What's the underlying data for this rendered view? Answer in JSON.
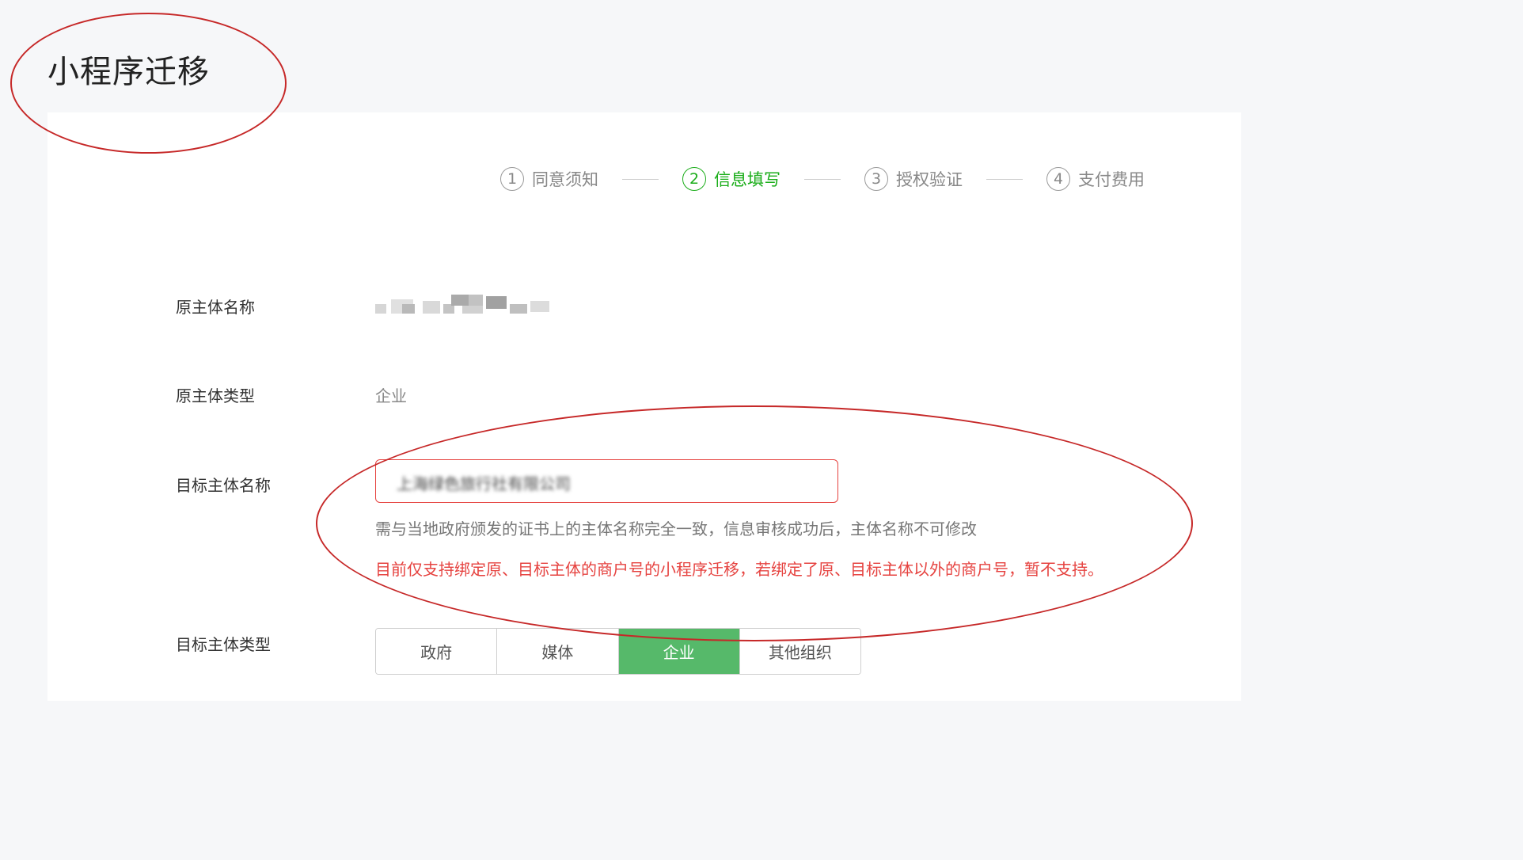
{
  "page_title": "小程序迁移",
  "steps": [
    {
      "num": "1",
      "label": "同意须知",
      "active": false
    },
    {
      "num": "2",
      "label": "信息填写",
      "active": true
    },
    {
      "num": "3",
      "label": "授权验证",
      "active": false
    },
    {
      "num": "4",
      "label": "支付费用",
      "active": false
    }
  ],
  "form": {
    "original_name_label": "原主体名称",
    "original_type_label": "原主体类型",
    "original_type_value": "企业",
    "target_name_label": "目标主体名称",
    "target_name_value": "上海绿色旅行社有限公司",
    "target_name_hint": "需与当地政府颁发的证书上的主体名称完全一致，信息审核成功后，主体名称不可修改",
    "target_name_warning": "目前仅支持绑定原、目标主体的商户号的小程序迁移，若绑定了原、目标主体以外的商户号，暂不支持。",
    "target_type_label": "目标主体类型",
    "target_type_options": [
      "政府",
      "媒体",
      "企业",
      "其他组织"
    ],
    "target_type_selected": "企业"
  },
  "colors": {
    "active_green": "#1aad19",
    "selected_green": "#56b96a",
    "warning_red": "#e64340",
    "annotation_red": "#c62828"
  }
}
